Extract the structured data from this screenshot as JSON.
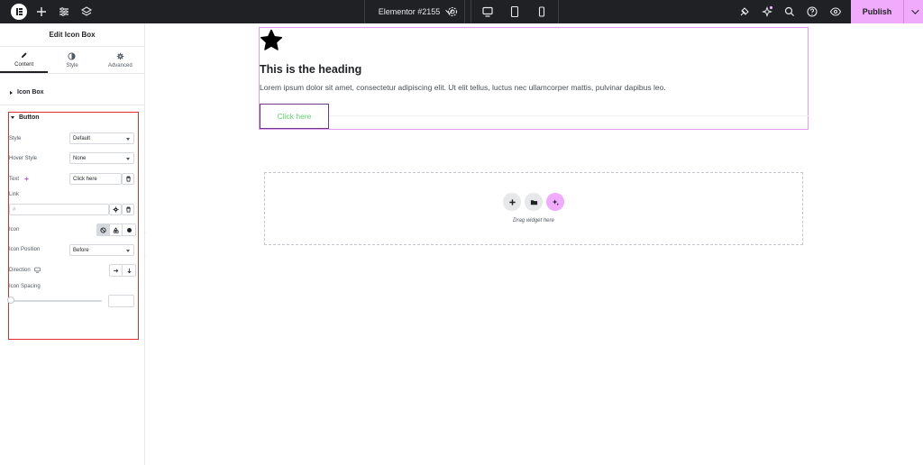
{
  "topbar": {
    "document_title": "Elementor #2155",
    "publish_label": "Publish",
    "icons": [
      "elementor-logo-icon",
      "add-icon",
      "settings-sliders-icon",
      "layers-icon",
      "site-settings-icon",
      "desktop-icon",
      "tablet-icon",
      "mobile-icon",
      "integrations-icon",
      "ai-notification-icon",
      "search-icon",
      "help-icon",
      "preview-icon"
    ]
  },
  "panel": {
    "title": "Edit Icon Box",
    "tabs": [
      {
        "label": "Content",
        "icon": "pencil-icon",
        "active": true
      },
      {
        "label": "Style",
        "icon": "contrast-icon",
        "active": false
      },
      {
        "label": "Advanced",
        "icon": "gear-icon",
        "active": false
      }
    ],
    "section_icon_box": "Icon Box",
    "section_button": "Button",
    "controls": {
      "style": {
        "label": "Style",
        "value": "Default"
      },
      "hover_style": {
        "label": "Hover Style",
        "value": "None"
      },
      "text": {
        "label": "Text",
        "value": "Click here"
      },
      "link": {
        "label": "Link",
        "placeholder": "#"
      },
      "icon": {
        "label": "Icon"
      },
      "icon_position": {
        "label": "Icon Position",
        "value": "Before"
      },
      "direction": {
        "label": "Direction"
      },
      "icon_spacing": {
        "label": "Icon Spacing",
        "value": ""
      }
    }
  },
  "canvas": {
    "heading": "This is the heading",
    "body": "Lorem ipsum dolor sit amet, consectetur adipiscing elit. Ut elit tellus, luctus nec ullamcorper mattis, pulvinar dapibus leo.",
    "button_label": "Click here",
    "drop_zone_text": "Drag widget here"
  },
  "colors": {
    "topbar_bg": "#1f2124",
    "publish_accent": "#f0abfc",
    "widget_outline": "#e39bf0",
    "button_text": "#61ce70",
    "highlight_border": "#e22c2c"
  }
}
